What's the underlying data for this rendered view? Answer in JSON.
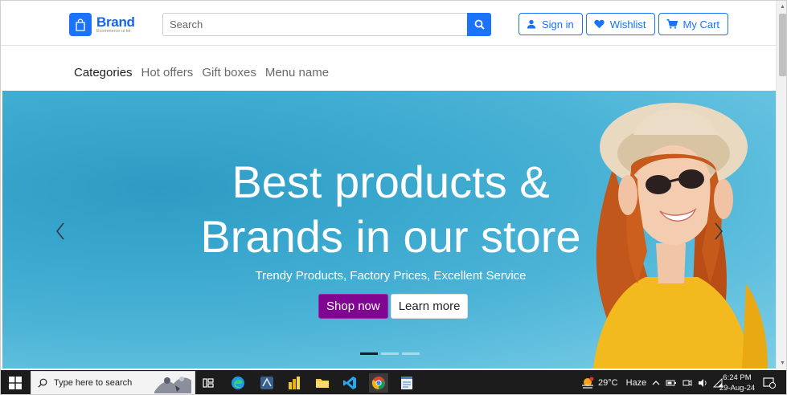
{
  "brand": {
    "name": "Brand",
    "tagline": "Ecommerce ui kit"
  },
  "search": {
    "placeholder": "Search"
  },
  "header_actions": [
    {
      "label": "Sign in",
      "icon": "user-icon"
    },
    {
      "label": "Wishlist",
      "icon": "heart-icon"
    },
    {
      "label": "My Cart",
      "icon": "cart-icon"
    }
  ],
  "nav": {
    "items": [
      "Categories",
      "Hot offers",
      "Gift boxes",
      "Menu name"
    ]
  },
  "hero": {
    "title_line1": "Best products &",
    "title_line2": "Brands in our store",
    "subtitle": "Trendy Products, Factory Prices, Excellent Service",
    "shop_label": "Shop now",
    "learn_label": "Learn more",
    "slides": 3,
    "active_slide": 1
  },
  "taskbar": {
    "search_placeholder": "Type here to search",
    "weather_temp": "29°C",
    "weather_condition": "Haze",
    "time": "6:24 PM",
    "date": "29-Aug-24",
    "notification_count": "1"
  },
  "colors": {
    "accent": "#1a73f8",
    "shop_button": "#800591",
    "hero_bg": "#4bb3d6"
  }
}
